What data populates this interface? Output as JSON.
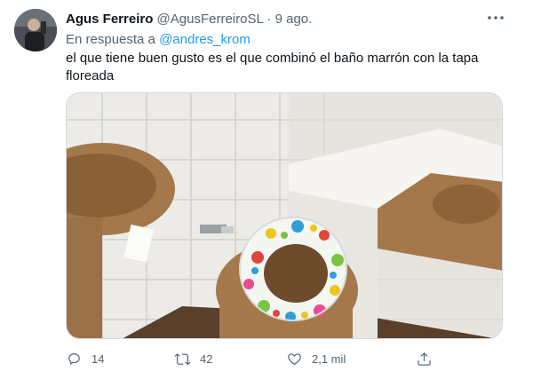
{
  "tweet": {
    "author_name": "Agus Ferreiro",
    "author_handle": "@AgusFerreiroSL",
    "separator": "·",
    "date": "9 ago.",
    "replying_prefix": "En respuesta a",
    "replying_to": "@andres_krom",
    "text": "el que tiene buen gusto es el que combinó el baño marrón con la tapa floreada"
  },
  "actions": {
    "replies": "14",
    "retweets": "42",
    "likes": "2,1 mil"
  },
  "icons": {
    "more": "more-horizontal-icon",
    "reply": "reply-icon",
    "retweet": "retweet-icon",
    "like": "heart-icon",
    "share": "share-icon"
  },
  "colors": {
    "link": "#1d9bf0",
    "secondary_text": "#536471",
    "fixture_brown": "#a4784a"
  }
}
